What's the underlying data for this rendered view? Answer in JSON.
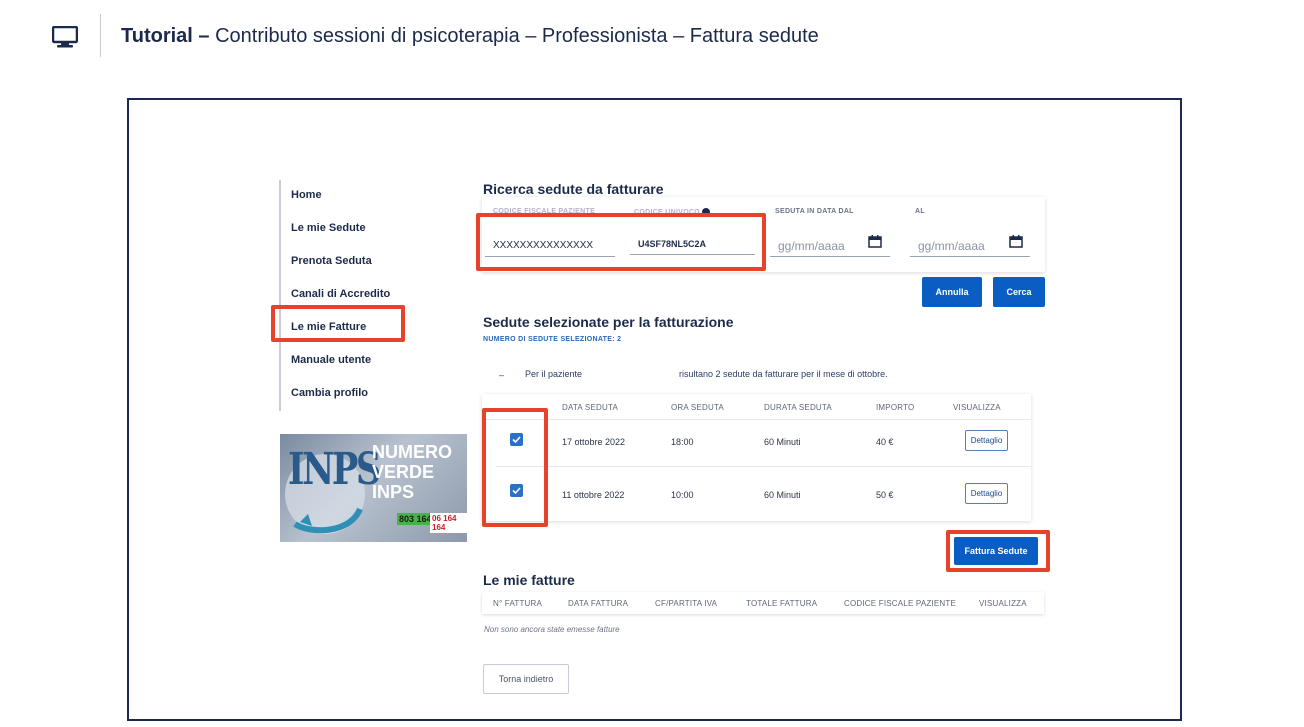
{
  "header": {
    "title_bold": "Tutorial –",
    "title_rest": " Contributo sessioni di psicoterapia – Professionista – Fattura sedute"
  },
  "sidebar": {
    "items": [
      {
        "label": "Home"
      },
      {
        "label": "Le mie Sedute"
      },
      {
        "label": "Prenota Seduta"
      },
      {
        "label": "Canali di Accredito"
      },
      {
        "label": "Le mie Fatture"
      },
      {
        "label": "Manuale utente"
      },
      {
        "label": "Cambia profilo"
      }
    ]
  },
  "banner": {
    "logo": "INPS",
    "line1": "NUMERO",
    "line2": "VERDE",
    "line3": "INPS",
    "num1": "803 164",
    "num2": "06 164 164"
  },
  "search": {
    "title": "Ricerca sedute da fatturare",
    "label_cf": "CODICE FISCALE PAZIENTE",
    "label_code": "CODICE UNIVOCO",
    "label_dal": "SEDUTA IN DATA DAL",
    "label_al": "AL",
    "cf_value": "XXXXXXXXXXXXXXX",
    "code_value": "U4SF78NL5C2A",
    "date_placeholder_dal": "gg/mm/aaaa",
    "date_placeholder_al": "gg/mm/aaaa",
    "annulla": "Annulla",
    "cerca": "Cerca"
  },
  "selected": {
    "title": "Sedute selezionate per la fatturazione",
    "count_label": "NUMERO DI SEDUTE SELEZIONATE: 2",
    "dash": "–",
    "patient_label": "Per il paziente",
    "summary": "risultano 2 sedute da fatturare per il mese di ottobre.",
    "columns": [
      "DATA SEDUTA",
      "ORA SEDUTA",
      "DURATA SEDUTA",
      "IMPORTO",
      "VISUALIZZA"
    ],
    "rows": [
      {
        "date": "17 ottobre 2022",
        "time": "18:00",
        "duration": "60 Minuti",
        "amount": "40 €",
        "action": "Dettaglio",
        "checked": true
      },
      {
        "date": "11 ottobre 2022",
        "time": "10:00",
        "duration": "60 Minuti",
        "amount": "50 €",
        "action": "Dettaglio",
        "checked": true
      }
    ],
    "fattura_button": "Fattura Sedute"
  },
  "fatture": {
    "title": "Le mie fatture",
    "columns": [
      "N° FATTURA",
      "DATA FATTURA",
      "CF/PARTITA IVA",
      "TOTALE FATTURA",
      "CODICE FISCALE PAZIENTE",
      "VISUALIZZA"
    ],
    "empty_note": "Non sono ancora state emesse fatture",
    "back_button": "Torna indietro"
  },
  "colors": {
    "accent": "#0a5dc2",
    "highlight": "#e8412c",
    "frame": "#1a2a55"
  }
}
